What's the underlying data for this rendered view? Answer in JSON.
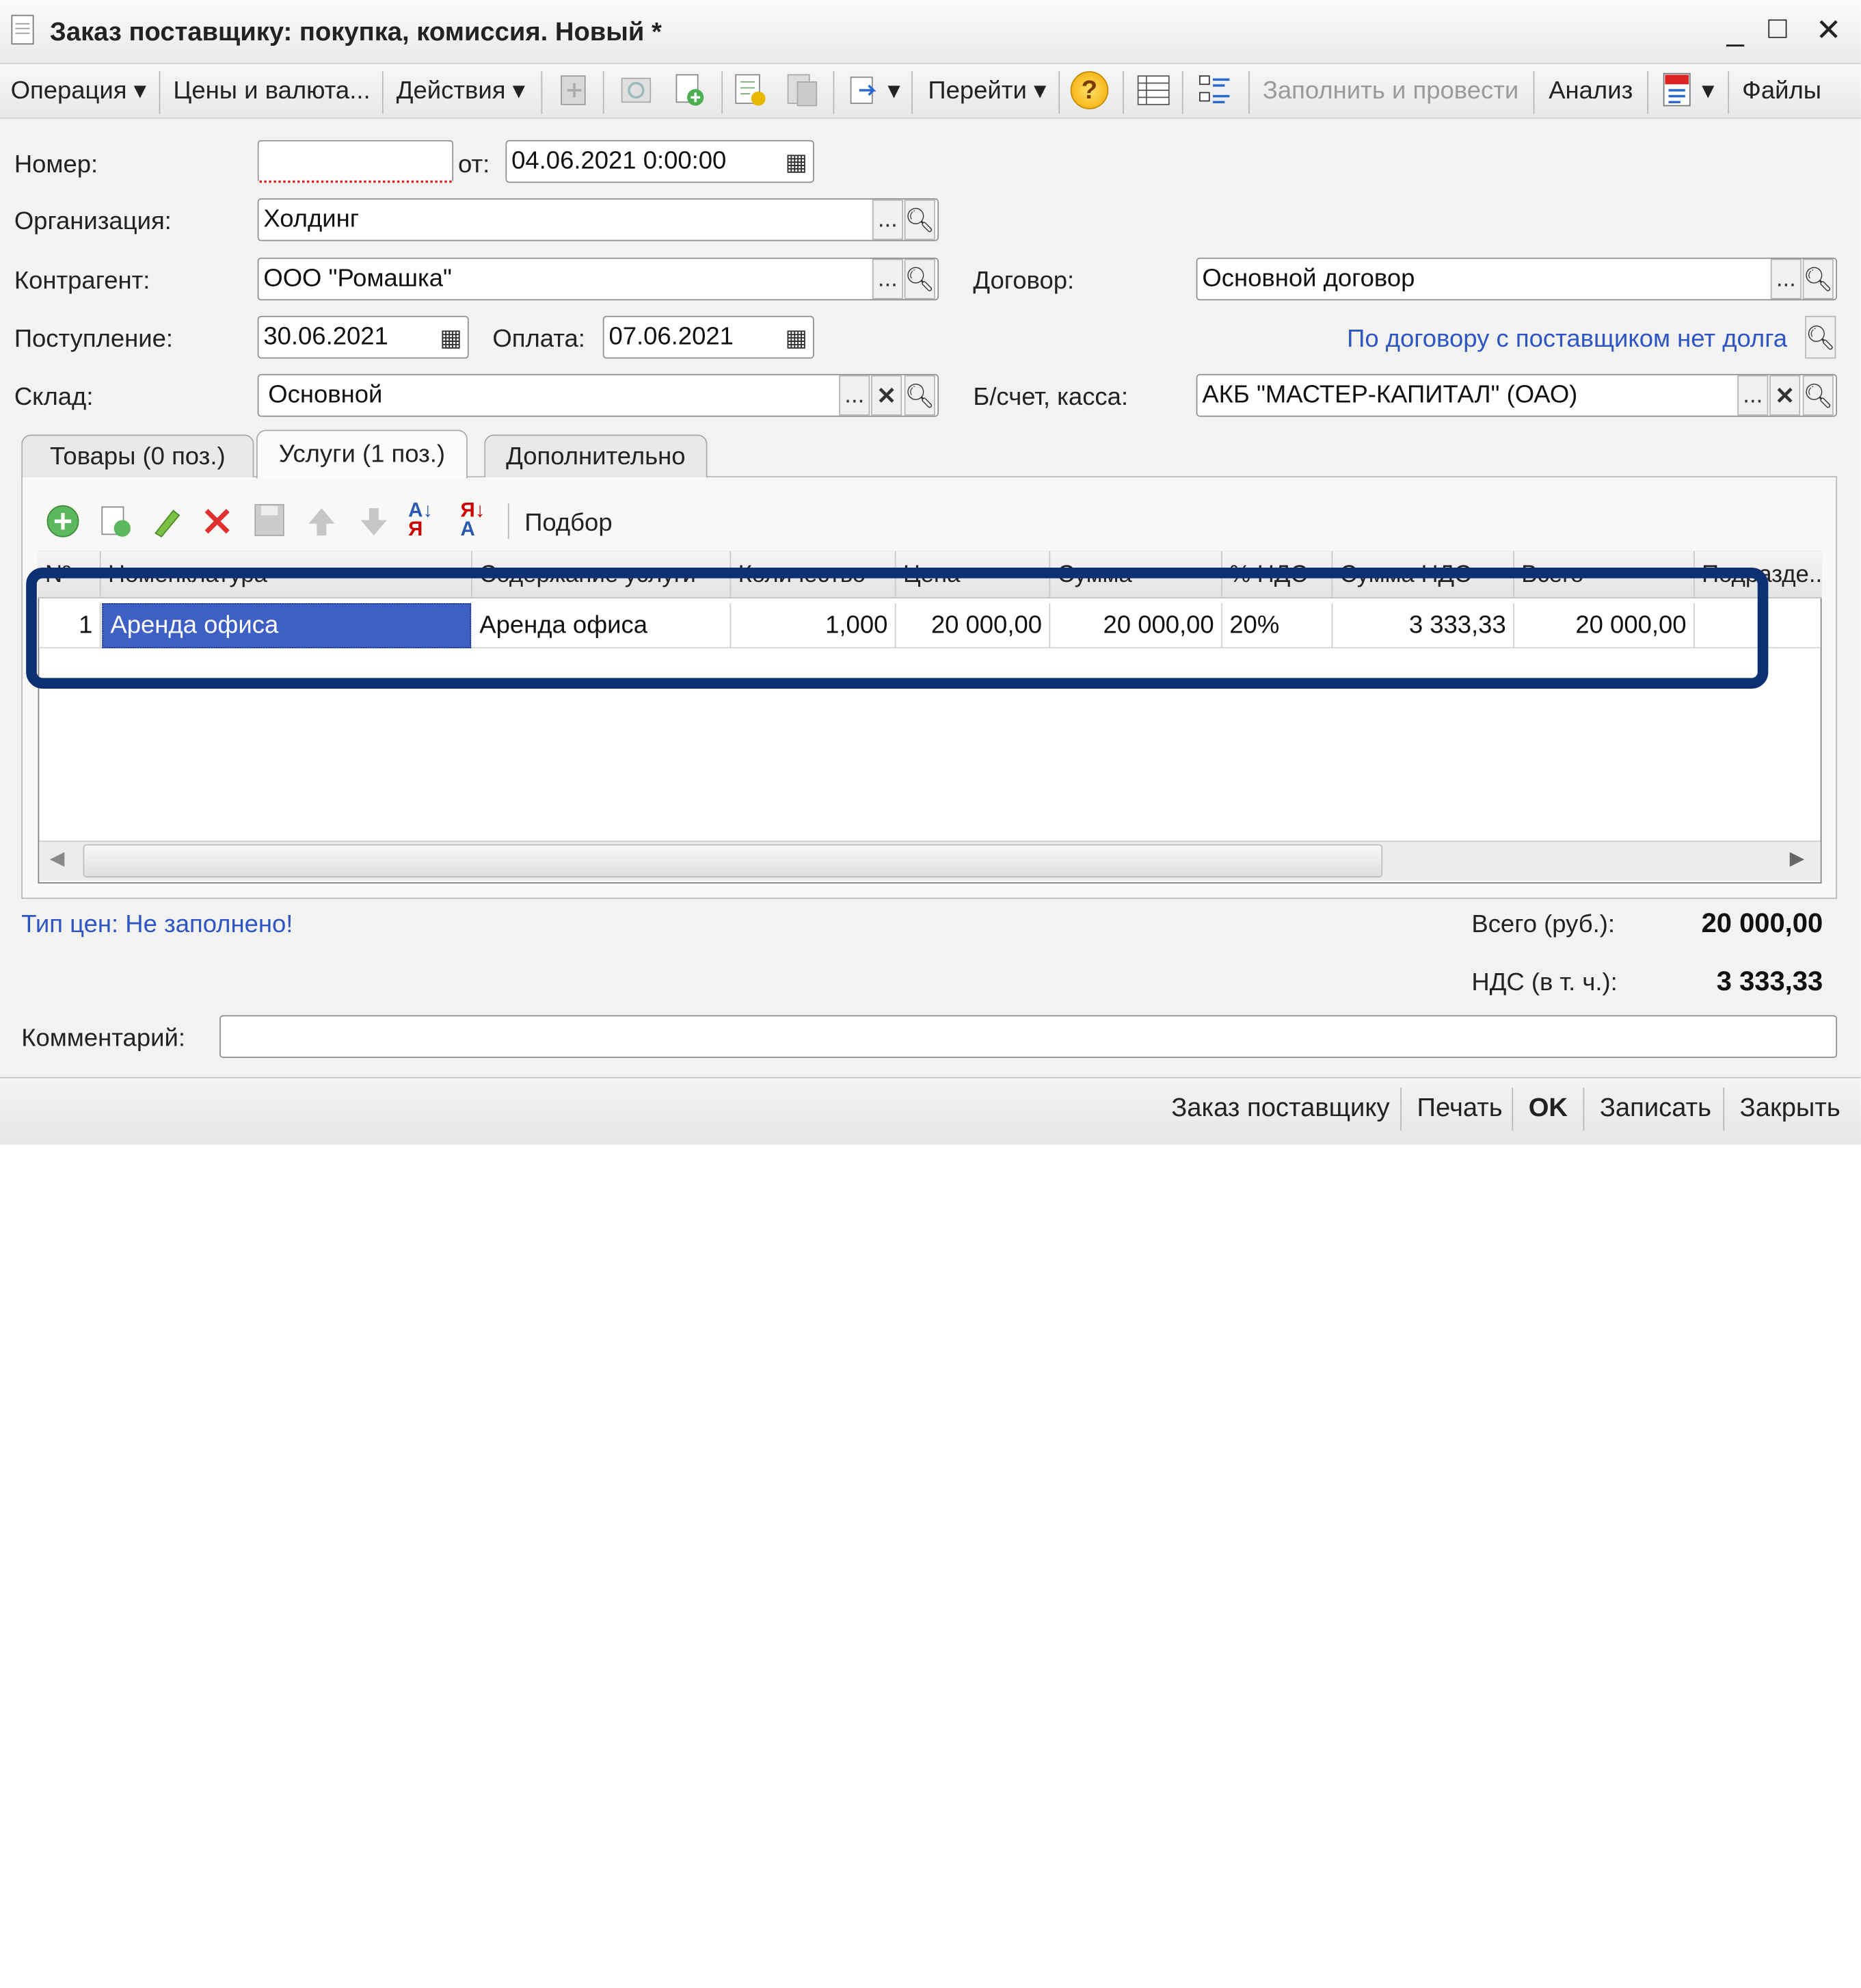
{
  "window": {
    "title": "Заказ поставщику: покупка, комиссия. Новый *",
    "minimize": "_",
    "maximize": "□",
    "close": "✕"
  },
  "toolbar": {
    "operation": "Операция",
    "prices": "Цены и валюта...",
    "actions": "Действия",
    "goto": "Перейти",
    "help": "?",
    "fill_post": "Заполнить и провести",
    "analysis": "Анализ",
    "files": "Файлы",
    "dropdown": "▾"
  },
  "form": {
    "number_label": "Номер:",
    "number_value": "",
    "date_label": "от:",
    "date_value": "04.06.2021  0:00:00",
    "org_label": "Организация:",
    "org_value": "Холдинг",
    "contractor_label": "Контрагент:",
    "contractor_value": "ООО \"Ромашка\"",
    "contract_label": "Договор:",
    "contract_value": "Основной договор",
    "receipt_label": "Поступление:",
    "receipt_value": "30.06.2021",
    "payment_label": "Оплата:",
    "payment_value": "07.06.2021",
    "debt_link": "По договору с поставщиком нет долга",
    "warehouse_label": "Склад:",
    "warehouse_value": "Основной",
    "bank_label": "Б/счет, касса:",
    "bank_value": "АКБ \"МАСТЕР-КАПИТАЛ\" (ОАО)",
    "ellipsis": "...",
    "clear": "✕"
  },
  "tabs": [
    {
      "label": "Товары (0 поз.)"
    },
    {
      "label": "Услуги (1 поз.)"
    },
    {
      "label": "Дополнительно"
    }
  ],
  "table_toolbar": {
    "pick": "Подбор"
  },
  "table": {
    "headers": [
      "Nº",
      "Номенклатура",
      "Содержание услуги",
      "Количество",
      "Цена",
      "Сумма",
      "% НДС",
      "Сумма НДС",
      "Всего",
      "Подразде..."
    ],
    "rows": [
      [
        "1",
        "Аренда офиса",
        "Аренда офиса",
        "1,000",
        "20 000,00",
        "20 000,00",
        "20%",
        "3 333,33",
        "20 000,00",
        ""
      ]
    ]
  },
  "summary": {
    "price_type_link": "Тип цен: Не заполнено!",
    "total_label": "Всего (руб.):",
    "total_value": "20 000,00",
    "vat_label": "НДС (в т. ч.):",
    "vat_value": "3 333,33",
    "comment_label": "Комментарий:",
    "comment_value": ""
  },
  "footer": {
    "order": "Заказ поставщику",
    "print": "Печать",
    "ok": "OK",
    "save": "Записать",
    "close": "Закрыть"
  },
  "colors": {
    "highlight": "#0d2f73",
    "selected_cell": "#3e5fc4",
    "link": "#2d56c4"
  }
}
